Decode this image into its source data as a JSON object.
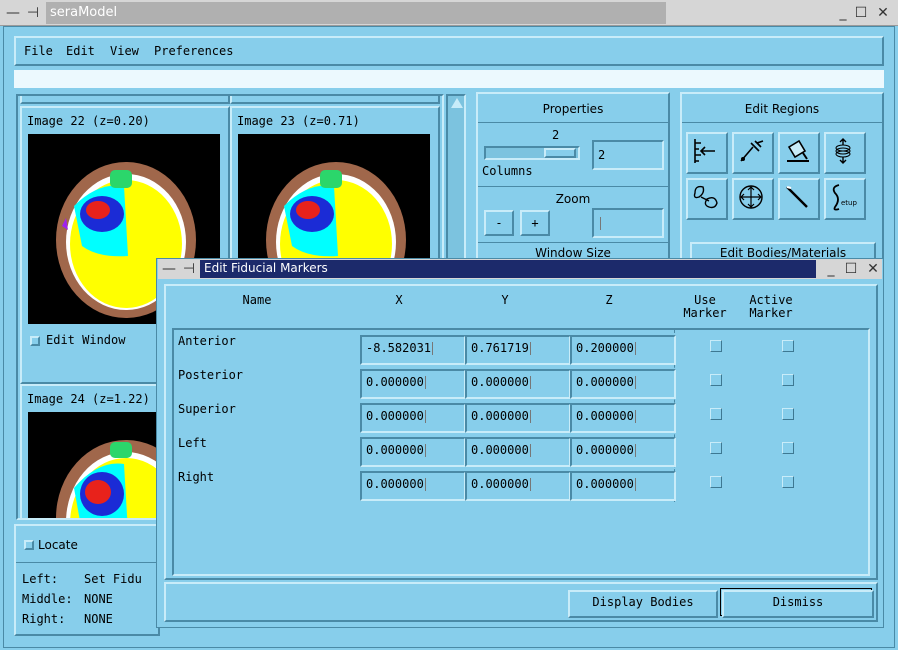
{
  "main_window": {
    "title": "seraModel",
    "menu": [
      "File",
      "Edit",
      "View",
      "Preferences"
    ]
  },
  "images": [
    {
      "label": "Image 22 (z=0.20)"
    },
    {
      "label": "Image 23 (z=0.71)"
    },
    {
      "label": "Image 24 (z=1.22)"
    }
  ],
  "edit_window_label": "Edit Window",
  "properties": {
    "title": "Properties",
    "columns_value": "2",
    "columns_label": "Columns",
    "columns_field": "2",
    "zoom_label": "Zoom",
    "zoom_minus": "-",
    "zoom_plus": "+",
    "window_size_label": "Window Size"
  },
  "edit_regions": {
    "title": "Edit Regions",
    "edit_bodies_button": "Edit Bodies/Materials",
    "tools": [
      "ruler-tool-icon",
      "paintbrush-tool-icon",
      "fill-tool-icon",
      "stack-tool-icon",
      "grow-region-tool-icon",
      "target-tool-icon",
      "wand-tool-icon",
      "setup-tool-icon"
    ],
    "setup_text": "Setup"
  },
  "locate": {
    "label": "Locate",
    "left_label": "Left:",
    "left_value": "Set Fidu",
    "middle_label": "Middle:",
    "middle_value": "NONE",
    "right_label": "Right:",
    "right_value": "NONE"
  },
  "dialog": {
    "title": "Edit Fiducial Markers",
    "headers": {
      "name": "Name",
      "x": "X",
      "y": "Y",
      "z": "Z",
      "use_marker": [
        "Use",
        "Marker"
      ],
      "active_marker": [
        "Active",
        "Marker"
      ]
    },
    "rows": [
      {
        "name": "Anterior",
        "x": "-8.582031",
        "y": "0.761719",
        "z": "0.200000"
      },
      {
        "name": "Posterior",
        "x": "0.000000",
        "y": "0.000000",
        "z": "0.000000"
      },
      {
        "name": "Superior",
        "x": "0.000000",
        "y": "0.000000",
        "z": "0.000000"
      },
      {
        "name": "Left",
        "x": "0.000000",
        "y": "0.000000",
        "z": "0.000000"
      },
      {
        "name": "Right",
        "x": "0.000000",
        "y": "0.000000",
        "z": "0.000000"
      }
    ],
    "display_bodies_button": "Display Bodies",
    "dismiss_button": "Dismiss"
  },
  "colors": {
    "background": "#87CEEB",
    "dialog_title_active": "#1c2a6b",
    "tissue_brown": "#a0674b",
    "tissue_yellow": "#ffff00",
    "tissue_cyan": "#00ffff",
    "tissue_blue": "#1b2bd6",
    "tissue_red": "#e8221b",
    "tissue_green": "#2bd66b"
  }
}
